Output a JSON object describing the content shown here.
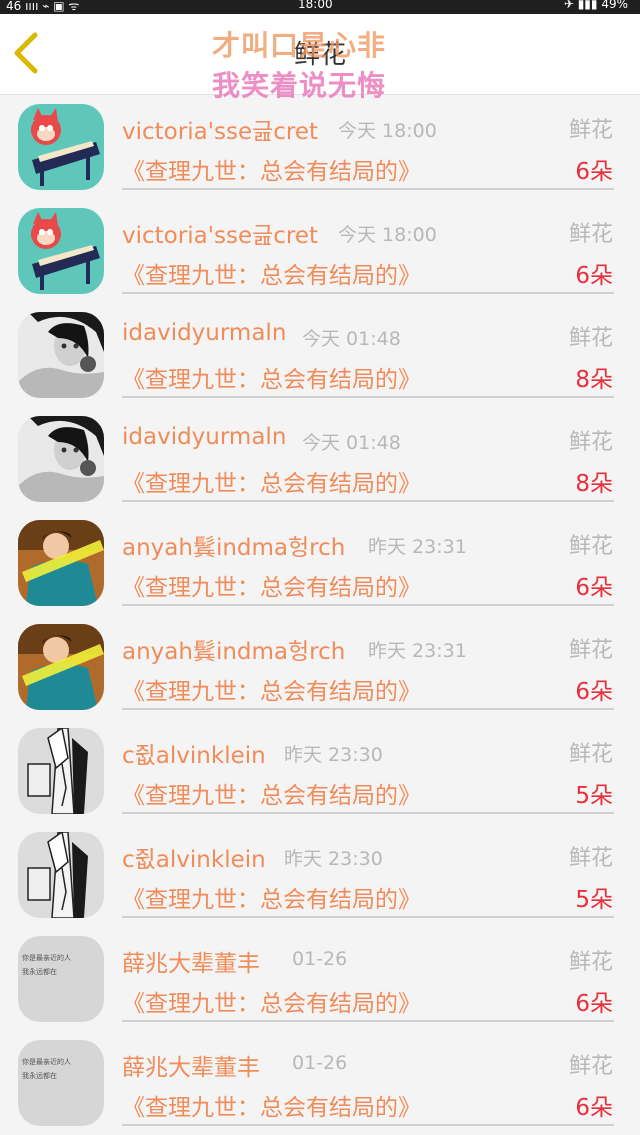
{
  "status_bar": {
    "left": "46 ıııı  ⌁  ▣  ᯤ",
    "time": "18:00",
    "right": "✈  ▮▮▮  49%"
  },
  "nav": {
    "title": "鲜花",
    "overlay_line1": "才叫口是心非",
    "overlay_line2": "我笑着说无悔"
  },
  "colors": {
    "accent_orange": "#f08c5a",
    "count_red": "#e8303a",
    "muted_gray": "#b8b8b8",
    "back_arrow": "#d9b800"
  },
  "rows": [
    {
      "username": "victoria'sse긆cret",
      "time": "今天 18:00",
      "gift": "鲜花",
      "book": "《查理九世：总会有结局的》",
      "count": "6朵",
      "avatar_icon": "cartoon-piano-icon"
    },
    {
      "username": "victoria'sse긆cret",
      "time": "今天 18:00",
      "gift": "鲜花",
      "book": "《查理九世：总会有结局的》",
      "count": "6朵",
      "avatar_icon": "cartoon-piano-icon"
    },
    {
      "username": "idavidyurmaln",
      "time": "今天 01:48",
      "gift": "鲜花",
      "book": "《查理九世：总会有结局的》",
      "count": "8朵",
      "avatar_icon": "bw-portrait-icon"
    },
    {
      "username": "idavidyurmaln",
      "time": "今天 01:48",
      "gift": "鲜花",
      "book": "《查理九世：总会有结局的》",
      "count": "8朵",
      "avatar_icon": "bw-portrait-icon"
    },
    {
      "username": "anyah鬂indma헝rch",
      "time": "昨天 23:31",
      "gift": "鲜花",
      "book": "《查理九世：总会有结局的》",
      "count": "6朵",
      "avatar_icon": "boy-photo-icon"
    },
    {
      "username": "anyah鬂indma헝rch",
      "time": "昨天 23:31",
      "gift": "鲜花",
      "book": "《查理九世：总会有结局的》",
      "count": "6朵",
      "avatar_icon": "boy-photo-icon"
    },
    {
      "username": "c쥢alvinklein",
      "time": "昨天 23:30",
      "gift": "鲜花",
      "book": "《查理九世：总会有结局的》",
      "count": "5朵",
      "avatar_icon": "sketch-figure-icon"
    },
    {
      "username": "c쥢alvinklein",
      "time": "昨天 23:30",
      "gift": "鲜花",
      "book": "《查理九世：总会有结局的》",
      "count": "5朵",
      "avatar_icon": "sketch-figure-icon"
    },
    {
      "username": "薛兆大辈董丰",
      "time": "01-26",
      "gift": "鲜花",
      "book": "《查理九世：总会有结局的》",
      "count": "6朵",
      "avatar_icon": "text-note-icon"
    },
    {
      "username": "薛兆大辈董丰",
      "time": "01-26",
      "gift": "鲜花",
      "book": "《查理九世：总会有结局的》",
      "count": "6朵",
      "avatar_icon": "text-note-icon"
    }
  ]
}
